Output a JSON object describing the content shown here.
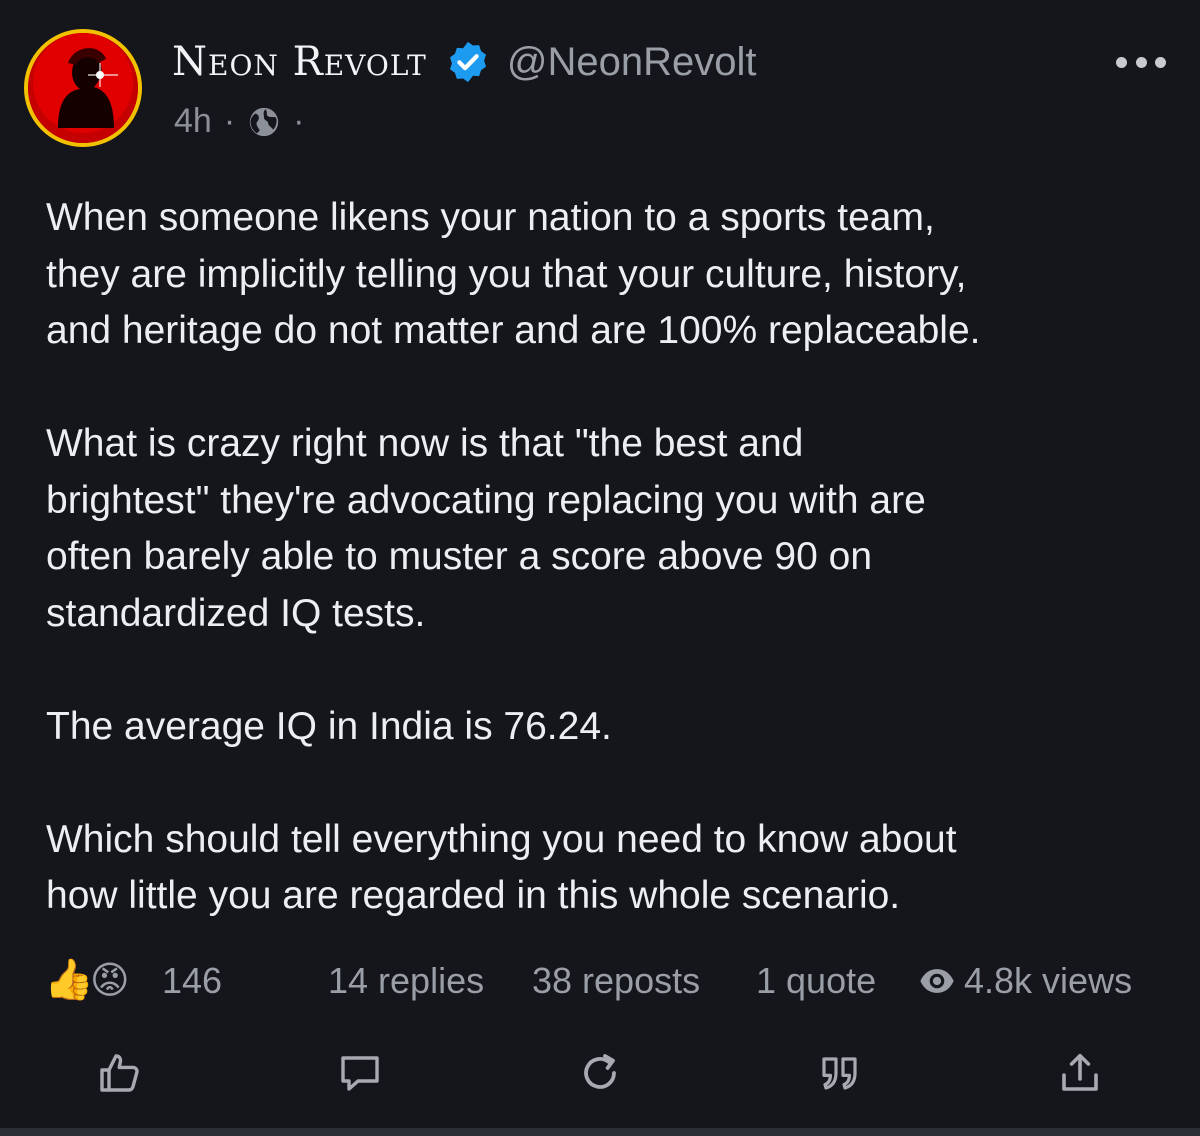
{
  "author": {
    "display_name": "Neon Revolt",
    "handle": "@NeonRevolt",
    "verified": true
  },
  "meta": {
    "time": "4h",
    "separator": "·",
    "visibility_icon": "globe-icon"
  },
  "post": {
    "paragraphs": [
      "When someone likens your nation to a sports team,\nthey are implicitly telling you that your culture, history,\nand heritage do not matter and are 100% replaceable.",
      "What is crazy right now is that \"the best and\nbrightest\" they're advocating replacing you with are\noften barely able to muster a score above 90 on\nstandardized IQ tests.",
      "The average IQ in India is 76.24.",
      "Which should tell everything you need to know about\nhow little you are regarded in this whole scenario."
    ]
  },
  "stats": {
    "reactions": [
      "👍",
      "😡"
    ],
    "reaction_count": "146",
    "replies": "14 replies",
    "reposts": "38 reposts",
    "quotes": "1 quote",
    "views": "4.8k views"
  },
  "actions": [
    "like-icon",
    "reply-icon",
    "repost-icon",
    "quote-icon",
    "share-icon"
  ],
  "colors": {
    "background": "#14161b",
    "text": "#eceef1",
    "muted": "#9a9ea6",
    "verified_blue": "#1d9bf0",
    "avatar_ring": "#f2c200",
    "avatar_red": "#d00000"
  }
}
